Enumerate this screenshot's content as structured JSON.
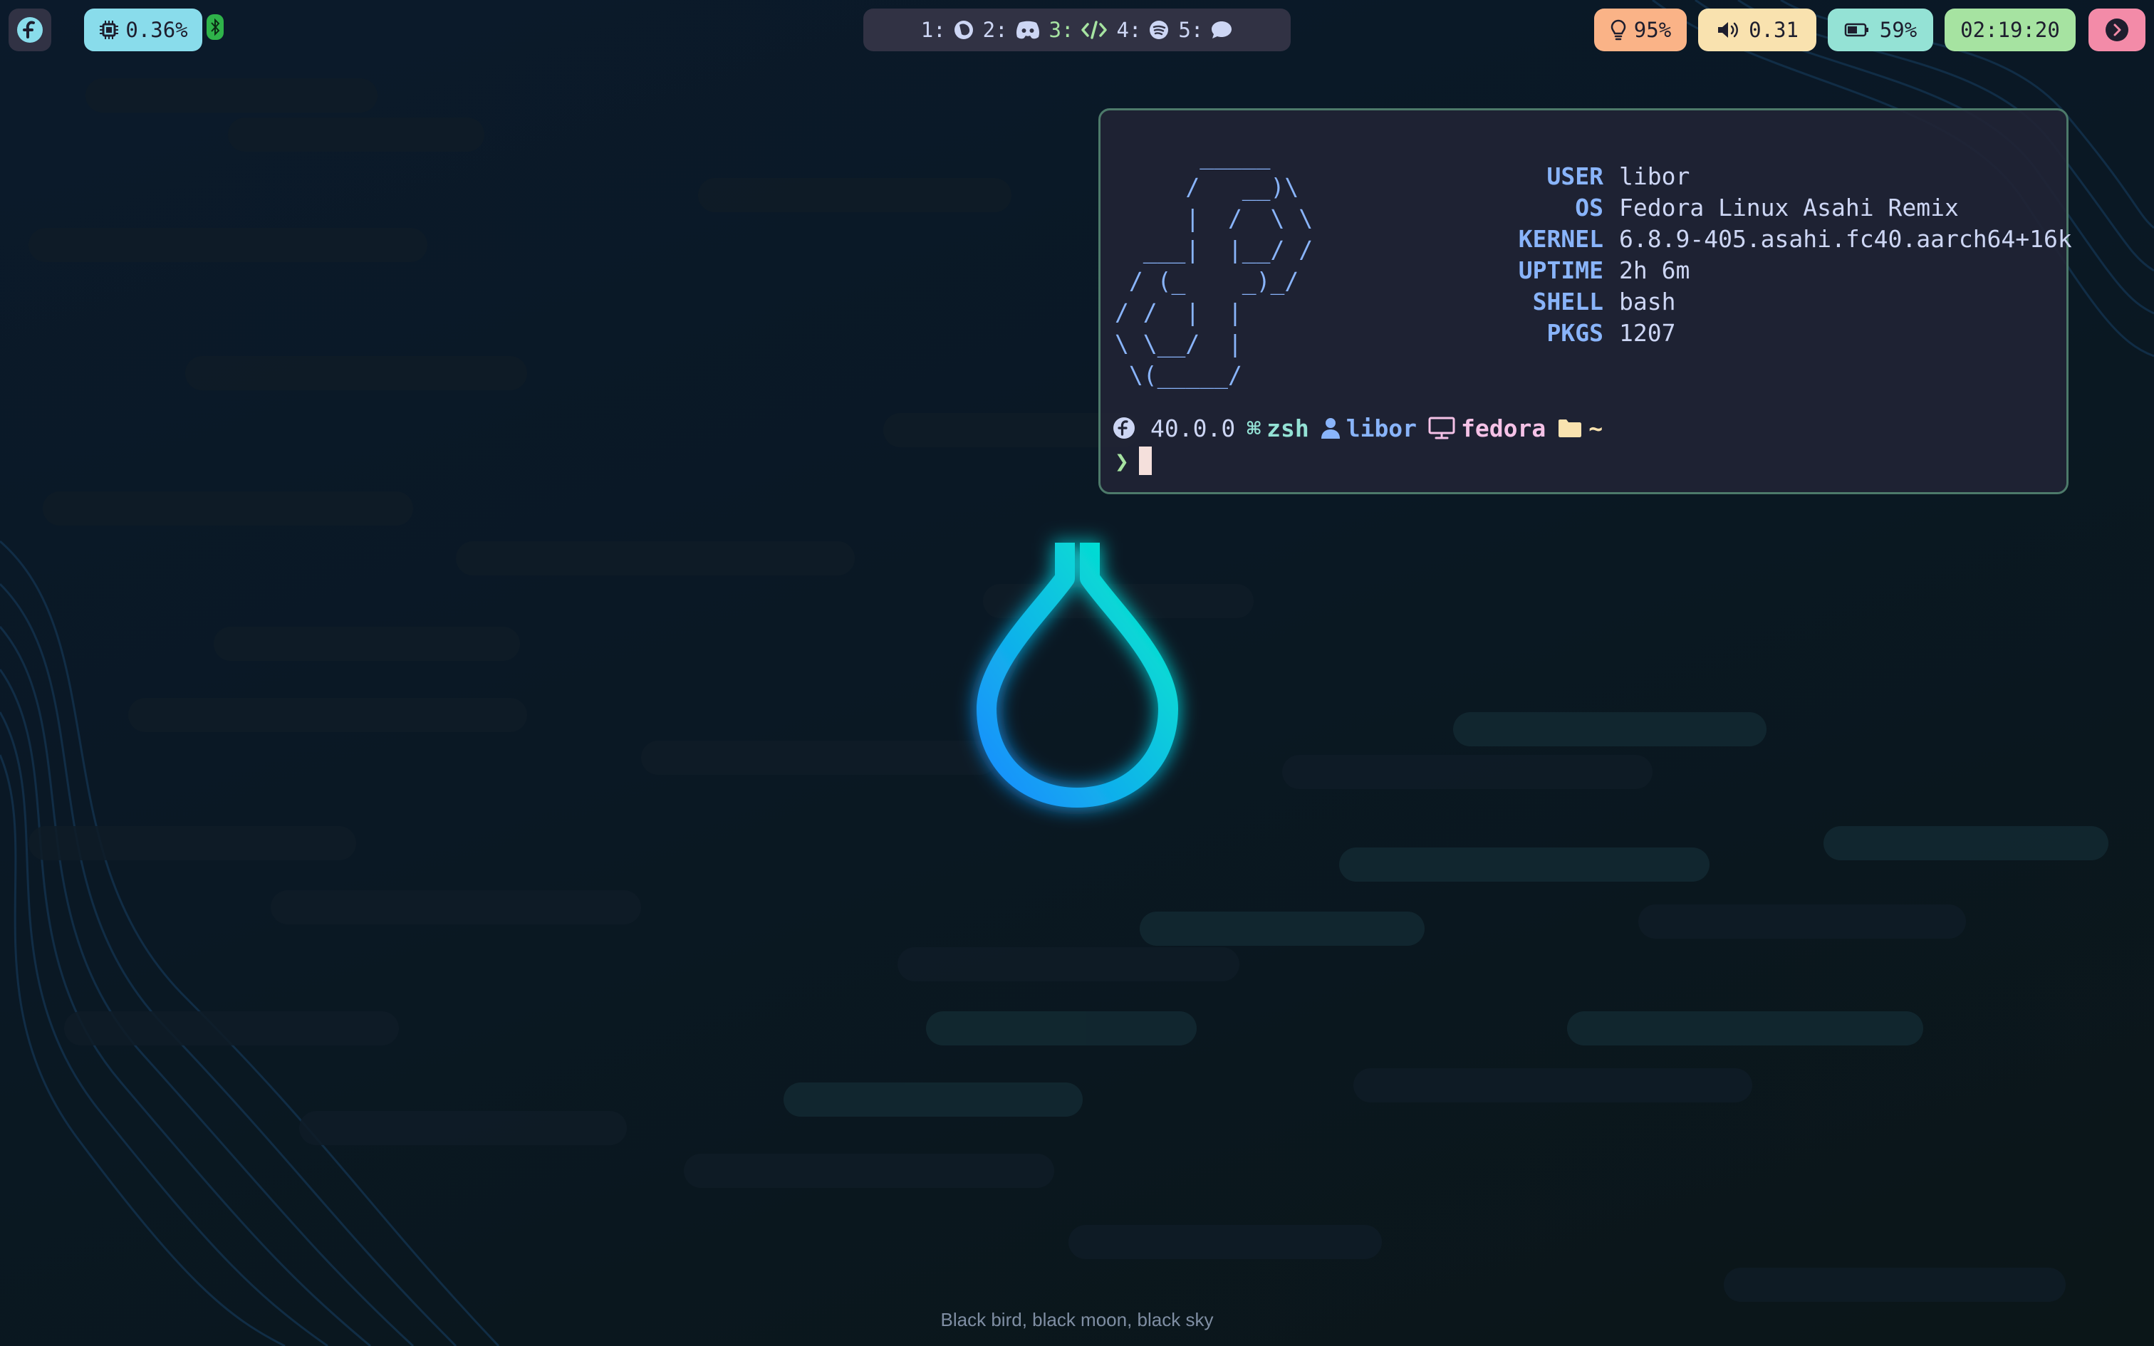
{
  "topbar": {
    "cpu": {
      "icon": "cpu-icon",
      "value": "0.36%",
      "color": "#89dceb"
    },
    "bluetooth": {
      "icon": "bluetooth-icon",
      "color": "#a6e3a1"
    },
    "workspaces": [
      {
        "label": "1:",
        "icon": "firefox-icon",
        "active": false
      },
      {
        "label": "2:",
        "icon": "discord-icon",
        "active": false
      },
      {
        "label": "3:",
        "icon": "code-icon",
        "active": true
      },
      {
        "label": "4:",
        "icon": "spotify-icon",
        "active": false
      },
      {
        "label": "5:",
        "icon": "chat-icon",
        "active": false
      }
    ],
    "brightness": {
      "icon": "lightbulb-icon",
      "value": "95%",
      "color": "#fab387"
    },
    "volume": {
      "icon": "speaker-icon",
      "value": "0.31",
      "color": "#f9e2af"
    },
    "battery": {
      "icon": "battery-icon",
      "value": "59%",
      "color": "#94e2d5"
    },
    "clock": {
      "value": "02:19:20",
      "color": "#a6e3a1"
    },
    "power": {
      "icon": "chevron-right-icon",
      "color": "#f38ba8"
    }
  },
  "terminal": {
    "ascii_logo": "      _____\n     /   __)\\\n     |  /  \\ \\\n  ___|  |__/ /\n / (_    _)_/\n/ /  |  |\n\\ \\__/  |\n \\(_____/",
    "info": [
      {
        "key": "USER",
        "value": "libor"
      },
      {
        "key": "OS",
        "value": "Fedora Linux Asahi Remix"
      },
      {
        "key": "KERNEL",
        "value": "6.8.9-405.asahi.fc40.aarch64+16k"
      },
      {
        "key": "UPTIME",
        "value": "2h 6m"
      },
      {
        "key": "SHELL",
        "value": "bash"
      },
      {
        "key": "PKGS",
        "value": "1207"
      }
    ],
    "prompt": {
      "os_version": "40.0.0",
      "shell": "zsh",
      "user": "libor",
      "host": "fedora",
      "dir": "~",
      "symbol": "❯"
    }
  },
  "wallpaper_caption": "Black bird, black moon, black sky",
  "colors": {
    "accent_cyan": "#00e0d0",
    "accent_blue": "#1ea0f0",
    "terminal_bg": "#202335",
    "terminal_border": "#4d7a6a"
  }
}
